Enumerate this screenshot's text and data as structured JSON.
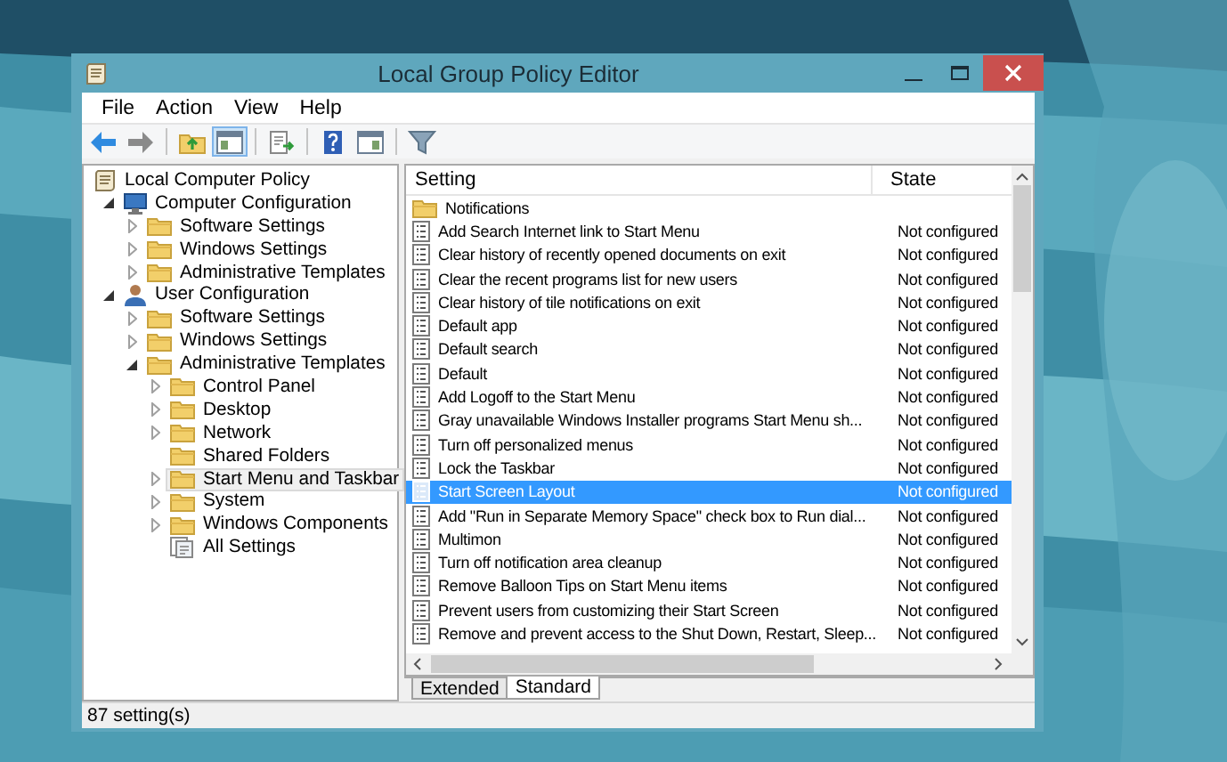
{
  "window": {
    "title": "Local Group Policy Editor"
  },
  "menu": [
    "File",
    "Action",
    "View",
    "Help"
  ],
  "toolbar": [
    {
      "kind": "back",
      "on": false
    },
    {
      "kind": "forward",
      "on": false
    },
    {
      "kind": "separator"
    },
    {
      "kind": "folder-up",
      "on": false
    },
    {
      "kind": "pane-toggle",
      "on": true
    },
    {
      "kind": "separator"
    },
    {
      "kind": "export",
      "on": false
    },
    {
      "kind": "separator"
    },
    {
      "kind": "help",
      "on": false
    },
    {
      "kind": "panel",
      "on": false
    },
    {
      "kind": "separator"
    },
    {
      "kind": "filter",
      "on": false
    }
  ],
  "tree": [
    {
      "label": "Local Computer Policy",
      "kind": "policy",
      "selected": false,
      "children": [
        {
          "label": "Computer Configuration",
          "kind": "computer",
          "expanded": true,
          "selected": false,
          "children": [
            {
              "label": "Software Settings",
              "kind": "folder",
              "expanded": false,
              "selected": false
            },
            {
              "label": "Windows Settings",
              "kind": "folder",
              "expanded": false,
              "selected": false
            },
            {
              "label": "Administrative Templates",
              "kind": "folder",
              "expanded": false,
              "selected": false
            }
          ]
        },
        {
          "label": "User Configuration",
          "kind": "user",
          "expanded": true,
          "selected": false,
          "children": [
            {
              "label": "Software Settings",
              "kind": "folder",
              "expanded": false,
              "selected": false
            },
            {
              "label": "Windows Settings",
              "kind": "folder",
              "expanded": false,
              "selected": false
            },
            {
              "label": "Administrative Templates",
              "kind": "folder",
              "expanded": true,
              "selected": false,
              "children": [
                {
                  "label": "Control Panel",
                  "kind": "folder",
                  "expanded": false,
                  "selected": false
                },
                {
                  "label": "Desktop",
                  "kind": "folder",
                  "expanded": false,
                  "selected": false
                },
                {
                  "label": "Network",
                  "kind": "folder",
                  "expanded": false,
                  "selected": false
                },
                {
                  "label": "Shared Folders",
                  "kind": "folder",
                  "selected": false
                },
                {
                  "label": "Start Menu and Taskbar",
                  "kind": "folder",
                  "expanded": false,
                  "selected": true
                },
                {
                  "label": "System",
                  "kind": "folder",
                  "expanded": false,
                  "selected": false
                },
                {
                  "label": "Windows Components",
                  "kind": "folder",
                  "expanded": false,
                  "selected": false
                },
                {
                  "label": "All Settings",
                  "kind": "all-settings",
                  "selected": false
                }
              ]
            }
          ]
        }
      ]
    }
  ],
  "list": {
    "columns": [
      "Setting",
      "State"
    ],
    "rows": [
      {
        "kind": "folder",
        "setting": "Notifications",
        "selected": false
      },
      {
        "kind": "setting",
        "setting": "Add Search Internet link to Start Menu",
        "state": "Not configured",
        "selected": false
      },
      {
        "kind": "setting",
        "setting": "Clear history of recently opened documents on exit",
        "state": "Not configured",
        "selected": false
      },
      {
        "kind": "setting",
        "setting": "Clear the recent programs list for new users",
        "state": "Not configured",
        "selected": false
      },
      {
        "kind": "setting",
        "setting": "Clear history of tile notifications on exit",
        "state": "Not configured",
        "selected": false
      },
      {
        "kind": "setting",
        "setting": "Default app",
        "state": "Not configured",
        "selected": false
      },
      {
        "kind": "setting",
        "setting": "Default search",
        "state": "Not configured",
        "selected": false
      },
      {
        "kind": "setting",
        "setting": "Default",
        "state": "Not configured",
        "selected": false
      },
      {
        "kind": "setting",
        "setting": "Add Logoff to the Start Menu",
        "state": "Not configured",
        "selected": false
      },
      {
        "kind": "setting",
        "setting": "Gray unavailable Windows Installer programs Start Menu sh...",
        "state": "Not configured",
        "selected": false
      },
      {
        "kind": "setting",
        "setting": "Turn off personalized menus",
        "state": "Not configured",
        "selected": false
      },
      {
        "kind": "setting",
        "setting": "Lock the Taskbar",
        "state": "Not configured",
        "selected": false
      },
      {
        "kind": "setting",
        "setting": "Start Screen Layout",
        "state": "Not configured",
        "selected": true
      },
      {
        "kind": "setting",
        "setting": "Add \"Run in Separate Memory Space\" check box to Run dial...",
        "state": "Not configured",
        "selected": false
      },
      {
        "kind": "setting",
        "setting": "Multimon",
        "state": "Not configured",
        "selected": false
      },
      {
        "kind": "setting",
        "setting": "Turn off notification area cleanup",
        "state": "Not configured",
        "selected": false
      },
      {
        "kind": "setting",
        "setting": "Remove Balloon Tips on Start Menu items",
        "state": "Not configured",
        "selected": false
      },
      {
        "kind": "setting",
        "setting": "Prevent users from customizing their Start Screen",
        "state": "Not configured",
        "selected": false
      },
      {
        "kind": "setting",
        "setting": "Remove and prevent access to the Shut Down, Restart, Sleep...",
        "state": "Not configured",
        "selected": false
      }
    ]
  },
  "tabs": [
    {
      "label": "Extended",
      "selected": false
    },
    {
      "label": "Standard",
      "selected": true
    }
  ],
  "status_bar": "87 setting(s)"
}
